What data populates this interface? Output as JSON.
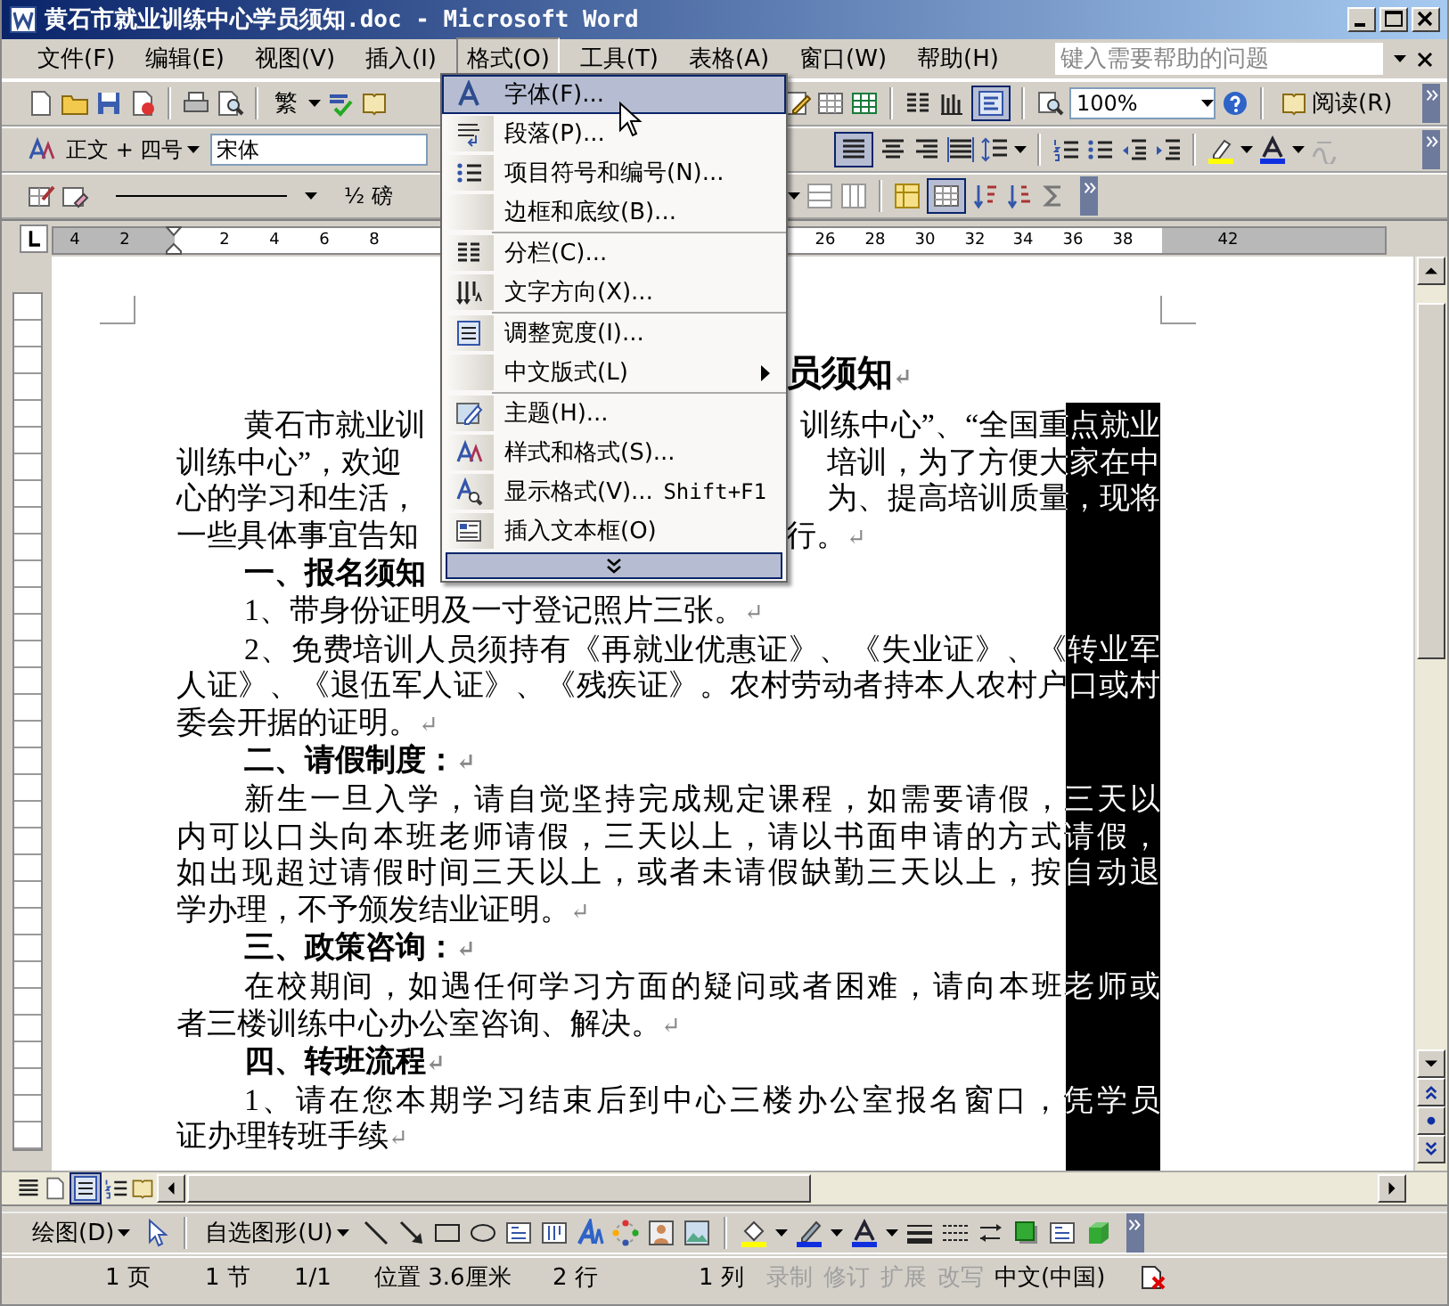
{
  "window": {
    "title": "黄石市就业训练中心学员须知.doc - Microsoft Word"
  },
  "menu_bar": {
    "items": [
      {
        "label": "文件(F)",
        "selected": false
      },
      {
        "label": "编辑(E)",
        "selected": false
      },
      {
        "label": "视图(V)",
        "selected": false
      },
      {
        "label": "插入(I)",
        "selected": false
      },
      {
        "label": "格式(O)",
        "selected": true
      },
      {
        "label": "工具(T)",
        "selected": false
      },
      {
        "label": "表格(A)",
        "selected": false
      },
      {
        "label": "窗口(W)",
        "selected": false
      },
      {
        "label": "帮助(H)",
        "selected": false
      }
    ],
    "help_placeholder": "键入需要帮助的问题"
  },
  "standard_toolbar": {
    "script_button": "繁",
    "zoom": "100%",
    "read_button": "阅读(R)"
  },
  "formatting_toolbar": {
    "style": "正文 + 四号",
    "font": "宋体"
  },
  "tables_toolbar": {
    "line_weight": "½ 磅"
  },
  "ruler": {
    "left_numbers": [
      "4",
      "2",
      "2",
      "4",
      "6",
      "8"
    ],
    "right_numbers": [
      "26",
      "28",
      "30",
      "32",
      "34",
      "36",
      "38",
      "42"
    ]
  },
  "format_menu": {
    "groups": [
      [
        {
          "label": "字体(F)...",
          "selected": true
        },
        {
          "label": "段落(P)...",
          "selected": false
        },
        {
          "label": "项目符号和编号(N)...",
          "selected": false
        },
        {
          "label": "边框和底纹(B)...",
          "selected": false
        }
      ],
      [
        {
          "label": "分栏(C)...",
          "selected": false
        },
        {
          "label": "文字方向(X)...",
          "selected": false
        }
      ],
      [
        {
          "label": "调整宽度(I)...",
          "selected": false
        },
        {
          "label": "中文版式(L)",
          "selected": false,
          "submenu": true
        }
      ],
      [
        {
          "label": "主题(H)...",
          "selected": false
        },
        {
          "label": "样式和格式(S)...",
          "selected": false
        },
        {
          "label": "显示格式(V)...",
          "selected": false,
          "shortcut": "Shift+F1"
        },
        {
          "label": "插入文本框(O)",
          "selected": false
        }
      ]
    ]
  },
  "document": {
    "column_selection": true,
    "paragraphs": [
      {
        "kind": "title",
        "lines": [
          {
            "right": "员须知"
          }
        ],
        "end_mark": "↵"
      },
      {
        "kind": "body",
        "lines": [
          {
            "left": "黄石市就业训",
            "right": "训练中心”、“全国重点就业"
          },
          {
            "left": "训练中心”，欢迎",
            "right": "培训，为了方便大家在中"
          },
          {
            "left": "心的学习和生活，",
            "right": "为、提高培训质量，现将"
          },
          {
            "left": "一些具体事宜告知",
            "right": "行。"
          }
        ],
        "end_mark": "↵"
      },
      {
        "kind": "heading",
        "lines": [
          {
            "left": "一、报名须知"
          }
        ]
      },
      {
        "kind": "body",
        "lines": [
          {
            "text": "1、带身份证明及一寸登记照片三张。"
          }
        ],
        "end_mark": "↵"
      },
      {
        "kind": "body",
        "lines": [
          {
            "text": "2、免费培训人员须持有《再就业优惠证》、《失业证》、《转业军"
          },
          {
            "text": "人证》、《退伍军人证》、《残疾证》。农村劳动者持本人农村户口或村"
          },
          {
            "text": "委会开据的证明。"
          }
        ],
        "end_mark": "↵"
      },
      {
        "kind": "heading",
        "lines": [
          {
            "text": "二、请假制度："
          }
        ],
        "end_mark": "↵"
      },
      {
        "kind": "body",
        "lines": [
          {
            "text": "新生一旦入学，请自觉坚持完成规定课程，如需要请假，三天以"
          },
          {
            "text": "内可以口头向本班老师请假，三天以上，请以书面申请的方式请假，"
          },
          {
            "text": "如出现超过请假时间三天以上，或者未请假缺勤三天以上，按自动退"
          },
          {
            "text": "学办理，不予颁发结业证明。"
          }
        ],
        "end_mark": "↵"
      },
      {
        "kind": "heading",
        "lines": [
          {
            "text": "三、政策咨询："
          }
        ],
        "end_mark": "↵"
      },
      {
        "kind": "body",
        "lines": [
          {
            "text": "在校期间，如遇任何学习方面的疑问或者困难，请向本班老师或"
          },
          {
            "text": "者三楼训练中心办公室咨询、解决。"
          }
        ],
        "end_mark": "↵"
      },
      {
        "kind": "heading",
        "lines": [
          {
            "text": "四、转班流程"
          }
        ],
        "end_mark": "↵"
      },
      {
        "kind": "body",
        "lines": [
          {
            "text": "1、请在您本期学习结束后到中心三楼办公室报名窗口，凭学员"
          },
          {
            "text": "证办理转班手续"
          }
        ],
        "end_mark": "↵"
      }
    ]
  },
  "drawing_toolbar": {
    "draw_menu": "绘图(D)",
    "autoshapes_menu": "自选图形(U)"
  },
  "status_bar": {
    "cells": [
      {
        "text": "1 页",
        "disabled": false
      },
      {
        "text": "1 节",
        "disabled": false
      },
      {
        "text": "1/1",
        "disabled": false
      },
      {
        "text": "位置 3.6厘米",
        "disabled": false
      },
      {
        "text": "2 行",
        "disabled": false
      },
      {
        "text": "1 列",
        "disabled": false
      },
      {
        "text": "录制",
        "disabled": true
      },
      {
        "text": "修订",
        "disabled": true
      },
      {
        "text": "扩展",
        "disabled": true
      },
      {
        "text": "改写",
        "disabled": true
      },
      {
        "text": "中文(中国)",
        "disabled": false
      }
    ]
  }
}
